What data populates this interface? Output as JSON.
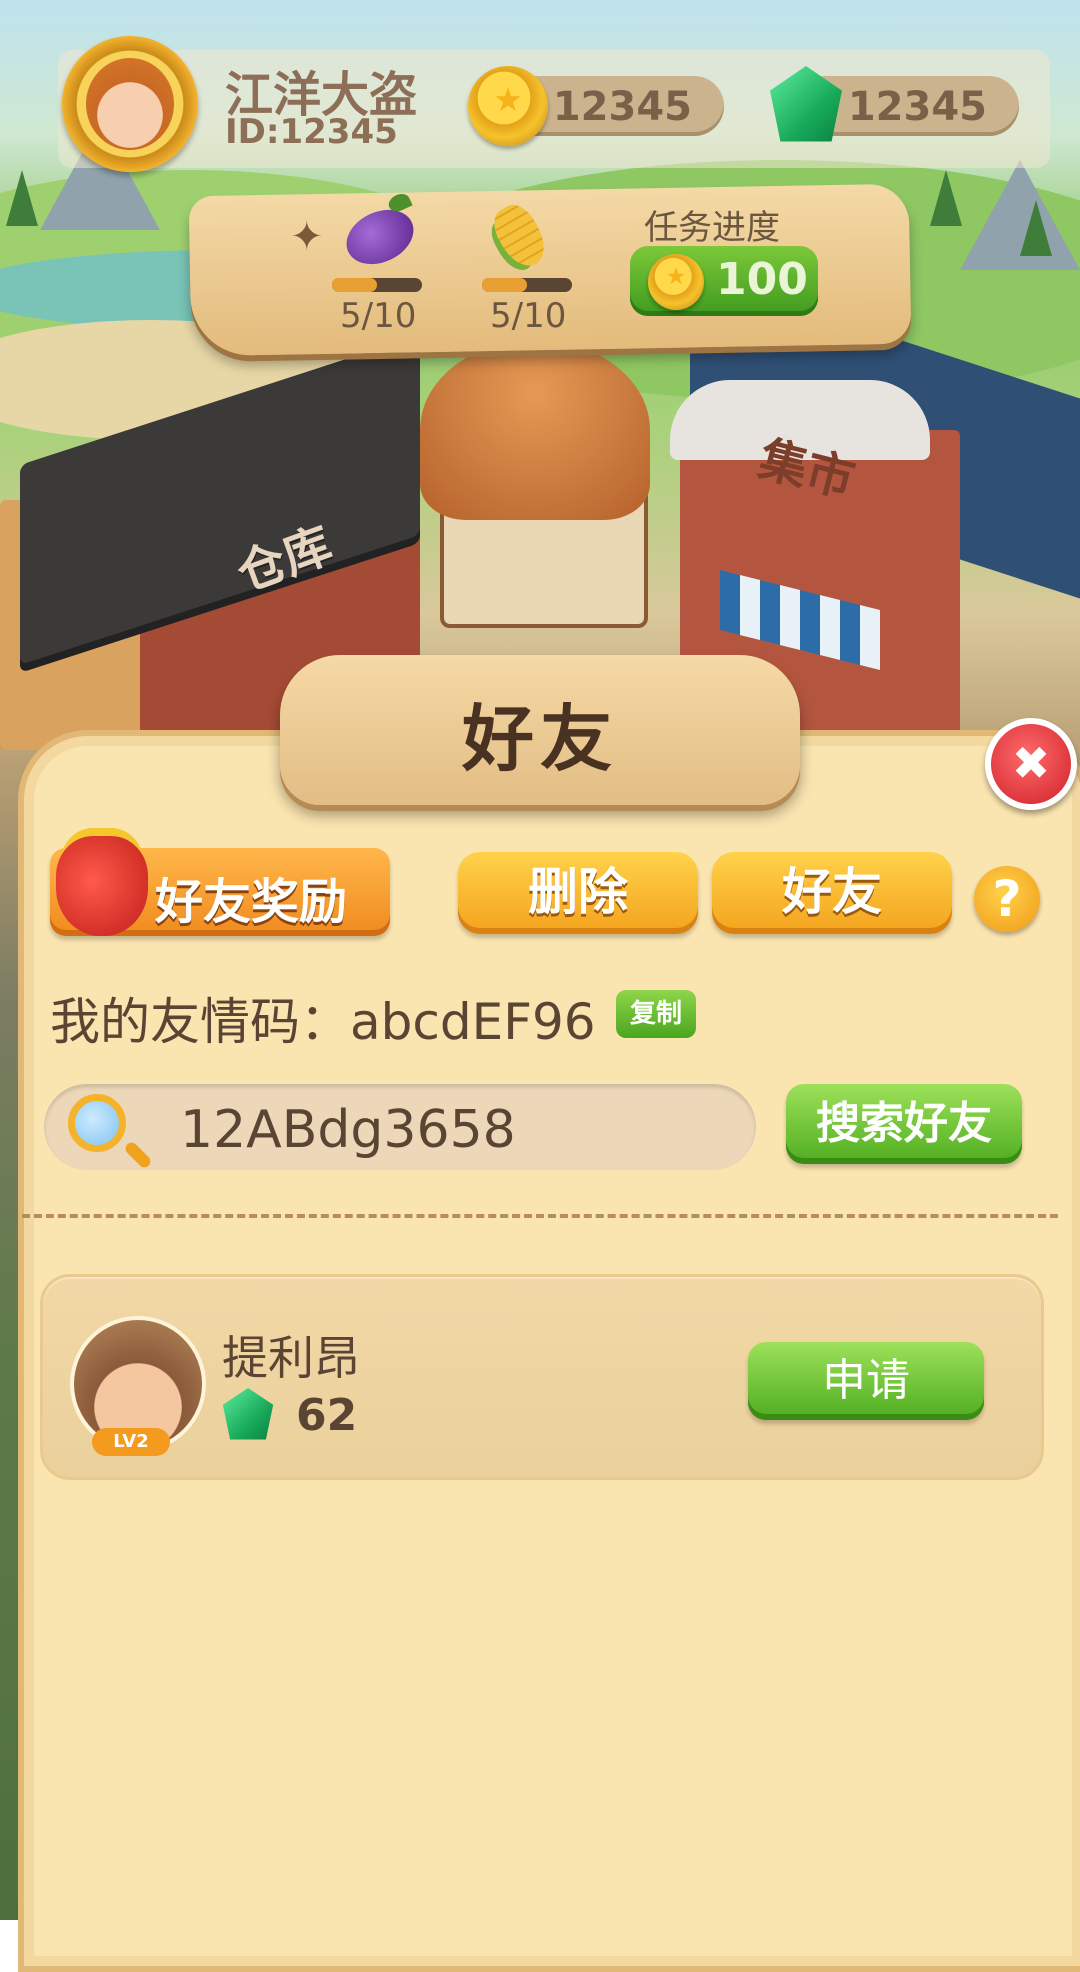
{
  "player": {
    "name": "江洋大盗",
    "id": "ID:12345",
    "coins": "12345",
    "gems": "12345"
  },
  "quest": {
    "items": [
      {
        "icon": "eggplant-icon",
        "progress": "5/10",
        "fraction": 0.5
      },
      {
        "icon": "corn-icon",
        "progress": "5/10",
        "fraction": 0.5
      }
    ],
    "title": "任务进度",
    "reward": "100"
  },
  "scene": {
    "warehouse_sign": "仓库",
    "market_sign": "集市"
  },
  "panel": {
    "title": "好友",
    "close_symbol": "✖",
    "reward_label": "好友奖励",
    "delete_label": "删除",
    "friends_label": "好友",
    "help_symbol": "?",
    "code_label": "我的友情码：abcdEF96",
    "copy_label": "复制",
    "search_value": "12ABdg3658",
    "search_button": "搜索好友"
  },
  "friends": [
    {
      "name": "提利昂",
      "level": "LV2",
      "gems": "62",
      "action": "申请"
    }
  ],
  "colors": {
    "panel_bg": "#fae4b0",
    "green_button": "#4fad1f",
    "orange_button": "#f4a21d",
    "close_red": "#d0202a"
  }
}
